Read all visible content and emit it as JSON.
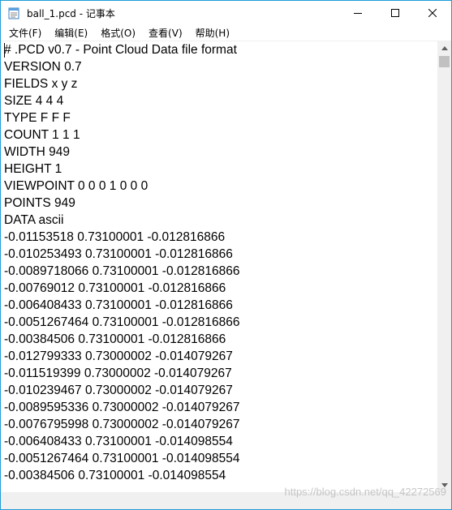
{
  "window": {
    "title": "ball_1.pcd - 记事本"
  },
  "menu": [
    {
      "label": "文件(F)"
    },
    {
      "label": "编辑(E)"
    },
    {
      "label": "格式(O)"
    },
    {
      "label": "查看(V)"
    },
    {
      "label": "帮助(H)"
    }
  ],
  "editor": {
    "lines": [
      "# .PCD v0.7 - Point Cloud Data file format",
      "VERSION 0.7",
      "FIELDS x y z",
      "SIZE 4 4 4",
      "TYPE F F F",
      "COUNT 1 1 1",
      "WIDTH 949",
      "HEIGHT 1",
      "VIEWPOINT 0 0 0 1 0 0 0",
      "POINTS 949",
      "DATA ascii",
      "-0.01153518 0.73100001 -0.012816866",
      "-0.010253493 0.73100001 -0.012816866",
      "-0.0089718066 0.73100001 -0.012816866",
      "-0.00769012 0.73100001 -0.012816866",
      "-0.006408433 0.73100001 -0.012816866",
      "-0.0051267464 0.73100001 -0.012816866",
      "-0.00384506 0.73100001 -0.012816866",
      "-0.012799333 0.73000002 -0.014079267",
      "-0.011519399 0.73000002 -0.014079267",
      "-0.010239467 0.73000002 -0.014079267",
      "-0.0089595336 0.73000002 -0.014079267",
      "-0.0076795998 0.73000002 -0.014079267",
      "-0.006408433 0.73100001 -0.014098554",
      "-0.0051267464 0.73100001 -0.014098554",
      "-0.00384506 0.73100001 -0.014098554"
    ]
  },
  "watermark": "https://blog.csdn.net/qq_42272569"
}
